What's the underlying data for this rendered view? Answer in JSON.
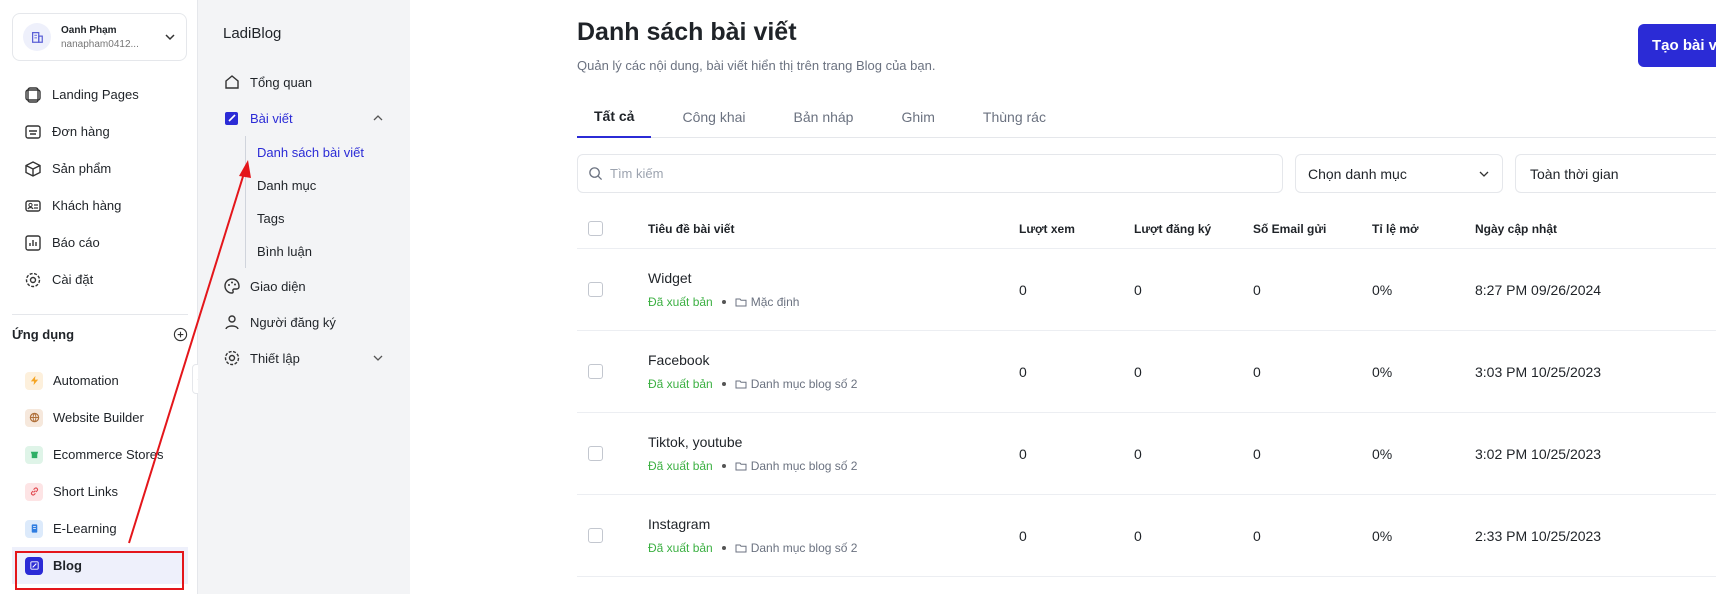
{
  "account": {
    "name": "Oanh Phạm",
    "email": "nanapham0412..."
  },
  "nav": [
    {
      "label": "Landing Pages",
      "icon": "landing-pages-icon"
    },
    {
      "label": "Đơn hàng",
      "icon": "orders-icon"
    },
    {
      "label": "Sản phẩm",
      "icon": "product-box-icon"
    },
    {
      "label": "Khách hàng",
      "icon": "customer-card-icon"
    },
    {
      "label": "Báo cáo",
      "icon": "report-chart-icon"
    },
    {
      "label": "Cài đặt",
      "icon": "gear-icon"
    }
  ],
  "apps_heading": "Ứng dụng",
  "apps": [
    {
      "label": "Automation",
      "icon": "lightning-icon",
      "color": "#f5a524"
    },
    {
      "label": "Website Builder",
      "icon": "globe-icon",
      "color": "#b0703a"
    },
    {
      "label": "Ecommerce Stores",
      "icon": "store-icon",
      "color": "#2fae66"
    },
    {
      "label": "Short Links",
      "icon": "link-icon",
      "color": "#e0484f"
    },
    {
      "label": "E-Learning",
      "icon": "book-icon",
      "color": "#2f7de1"
    },
    {
      "label": "Blog",
      "icon": "blog-edit-icon",
      "color": "#2b2bd6"
    }
  ],
  "sub": {
    "title": "LadiBlog",
    "overview": "Tổng quan",
    "posts": "Bài viết",
    "children": [
      "Danh sách bài viết",
      "Danh mục",
      "Tags",
      "Bình luận"
    ],
    "appearance": "Giao diện",
    "subscribers": "Người đăng ký",
    "settings": "Thiết lập"
  },
  "main": {
    "title": "Danh sách bài viết",
    "subtitle": "Quản lý các nội dung, bài viết hiển thị trên trang Blog của bạn.",
    "create_label": "Tạo bài v",
    "tabs": [
      "Tất cả",
      "Công khai",
      "Bản nháp",
      "Ghim",
      "Thùng rác"
    ],
    "search_placeholder": "Tìm kiếm",
    "category_select": "Chọn danh mục",
    "time_select": "Toàn thời gian"
  },
  "table": {
    "headers": [
      "Tiêu đề bài viết",
      "Lượt xem",
      "Lượt đăng ký",
      "Số Email gửi",
      "Tỉ lệ mở",
      "Ngày cập nhật"
    ],
    "rows": [
      {
        "title": "Widget",
        "status": "Đã xuất bản",
        "category": "Mặc định",
        "views": "0",
        "signups": "0",
        "emails": "0",
        "open_rate": "0%",
        "updated": "8:27 PM 09/26/2024"
      },
      {
        "title": "Facebook",
        "status": "Đã xuất bản",
        "category": "Danh mục blog số 2",
        "views": "0",
        "signups": "0",
        "emails": "0",
        "open_rate": "0%",
        "updated": "3:03 PM 10/25/2023"
      },
      {
        "title": "Tiktok, youtube",
        "status": "Đã xuất bản",
        "category": "Danh mục blog số 2",
        "views": "0",
        "signups": "0",
        "emails": "0",
        "open_rate": "0%",
        "updated": "3:02 PM 10/25/2023"
      },
      {
        "title": "Instagram",
        "status": "Đã xuất bản",
        "category": "Danh mục blog số 2",
        "views": "0",
        "signups": "0",
        "emails": "0",
        "open_rate": "0%",
        "updated": "2:33 PM 10/25/2023"
      }
    ]
  },
  "colors": {
    "accent": "#2b2bd6",
    "published": "#3cb043",
    "annotation": "#e4161b"
  }
}
